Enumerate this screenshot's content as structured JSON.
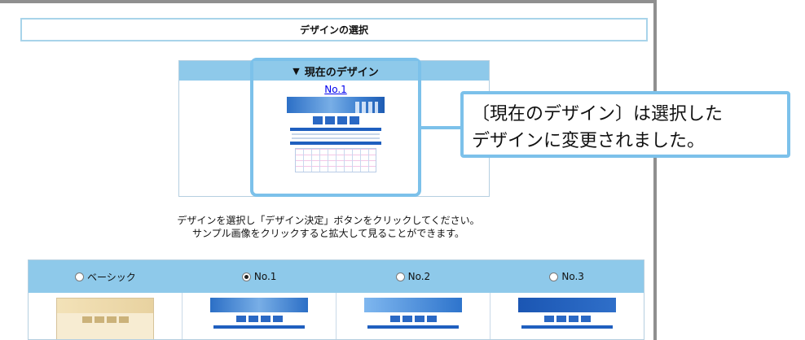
{
  "page": {
    "title": "デザインの選択"
  },
  "current": {
    "header": "現在のデザイン",
    "link_label": "No.1"
  },
  "callout": {
    "line1": "〔現在のデザイン〕は選択した",
    "line2": "デザインに変更されました。"
  },
  "instructions": {
    "line1": "デザインを選択し「デザイン決定」ボタンをクリックしてください。",
    "line2": "サンプル画像をクリックすると拡大して見ることができます。"
  },
  "designs": {
    "options": [
      {
        "label": "ベーシック",
        "selected": false
      },
      {
        "label": "No.1",
        "selected": true
      },
      {
        "label": "No.2",
        "selected": false
      },
      {
        "label": "No.3",
        "selected": false
      }
    ]
  },
  "colors": {
    "accent_blue": "#8ec9ea",
    "callout_border": "#7cc1ea",
    "link": "#0000ee"
  },
  "icons": {
    "header_marker": "triangle-down-icon"
  }
}
